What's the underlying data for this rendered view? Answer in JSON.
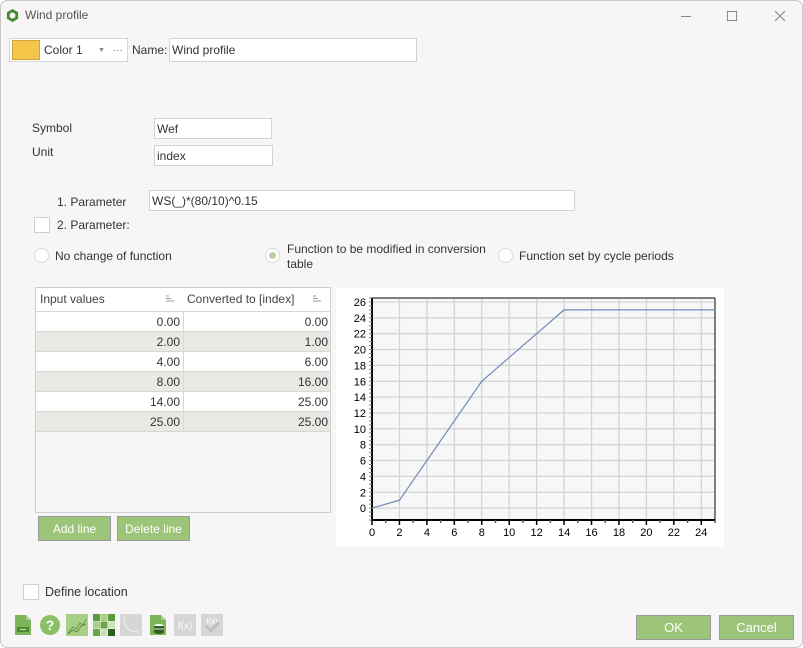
{
  "window": {
    "title": "Wind profile",
    "controls": {
      "minimize": "minimize",
      "maximize": "maximize",
      "close": "close"
    }
  },
  "header": {
    "color_label": "Color 1",
    "color_value": "#f5c64a",
    "more_label": "···",
    "name_label": "Name:",
    "name_value": "Wind profile"
  },
  "form": {
    "symbol_label": "Symbol",
    "symbol_value": "Wef",
    "unit_label": "Unit",
    "unit_value": "index",
    "param1_label": "1. Parameter",
    "param1_value": "WS(_)*(80/10)^0.15",
    "param2_label": "2. Parameter:",
    "param2_checked": false
  },
  "function_mode": {
    "options": [
      {
        "label": "No change of function",
        "checked": false
      },
      {
        "label": "Function to be modified in conversion table",
        "checked": true
      },
      {
        "label": "Function set by cycle periods",
        "checked": false
      }
    ]
  },
  "table": {
    "headers": [
      "Input values",
      "Converted to [index]"
    ],
    "rows": [
      [
        "0.00",
        "0.00"
      ],
      [
        "2.00",
        "1.00"
      ],
      [
        "4.00",
        "6.00"
      ],
      [
        "8.00",
        "16.00"
      ],
      [
        "14.00",
        "25.00"
      ],
      [
        "25.00",
        "25.00"
      ]
    ],
    "add_label": "Add line",
    "delete_label": "Delete line"
  },
  "chart_data": {
    "type": "line",
    "title": "",
    "xlabel": "",
    "ylabel": "",
    "x": [
      0,
      2,
      4,
      8,
      14,
      25
    ],
    "series": [
      {
        "name": "Converted to [index]",
        "values": [
          0,
          1,
          6,
          16,
          25,
          25
        ],
        "color": "#7088bb"
      }
    ],
    "xlim": [
      0,
      25
    ],
    "ylim": [
      -1.5,
      26.5
    ],
    "xticks": [
      0,
      2,
      4,
      6,
      8,
      10,
      12,
      14,
      16,
      18,
      20,
      22,
      24
    ],
    "yticks": [
      0,
      2,
      4,
      6,
      8,
      10,
      12,
      14,
      16,
      18,
      20,
      22,
      24,
      26
    ],
    "grid": true,
    "legend": "none"
  },
  "footer": {
    "define_location_label": "Define location",
    "define_location_checked": false,
    "toolbar_icons": [
      "document-icon",
      "help-icon",
      "chart-icon",
      "matrix-icon",
      "curve-icon",
      "database-document-icon",
      "function-icon",
      "function-check-icon"
    ],
    "ok_label": "OK",
    "cancel_label": "Cancel"
  },
  "colors": {
    "accent_green": "#9dc57a",
    "row_alt": "#e8ebe4",
    "series_line": "#7088bb"
  }
}
